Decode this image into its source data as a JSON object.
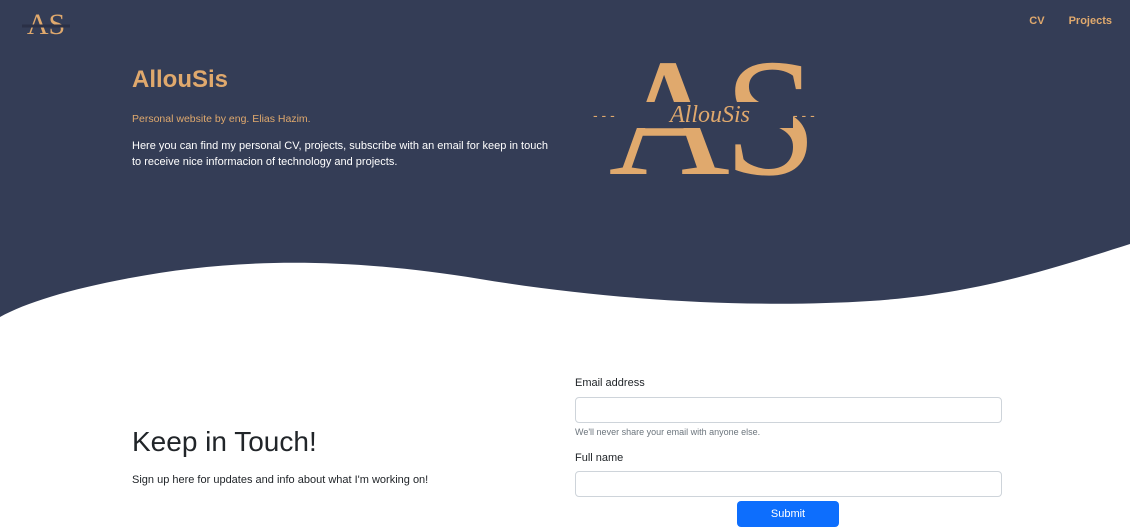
{
  "colors": {
    "hero_bg": "#343d56",
    "accent": "#e0a96d",
    "primary_button": "#0d6efd"
  },
  "nav": {
    "logo_letters": "AS",
    "links": [
      {
        "label": "CV"
      },
      {
        "label": "Projects"
      }
    ]
  },
  "hero": {
    "title": "AllouSis",
    "subtitle": "Personal website by eng. Elias Hazim.",
    "description": "Here you can find my personal CV, projects, subscribe with an email for keep in touch to receive nice informacion of technology and projects.",
    "logo": {
      "letters": "AS",
      "script": "AllouSis",
      "dashes": "- - -"
    }
  },
  "subscribe": {
    "title": "Keep in Touch!",
    "description": "Sign up here for updates and info about what I'm working on!"
  },
  "form": {
    "email_label": "Email address",
    "email_value": "",
    "email_help": "We'll never share your email with anyone else.",
    "name_label": "Full name",
    "name_value": "",
    "submit_label": "Submit"
  }
}
